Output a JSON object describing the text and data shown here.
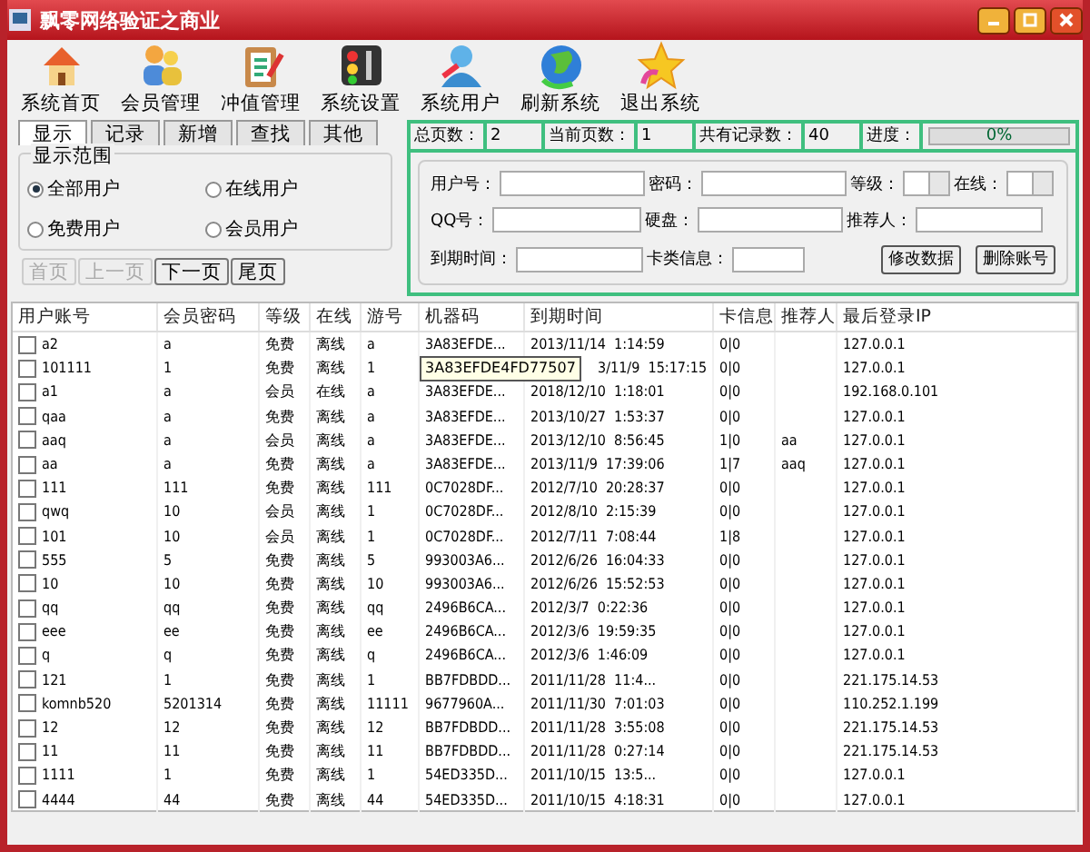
{
  "window": {
    "title": "飘零网络验证之商业"
  },
  "toolbar": [
    {
      "label": "系统首页"
    },
    {
      "label": "会员管理"
    },
    {
      "label": "冲值管理"
    },
    {
      "label": "系统设置"
    },
    {
      "label": "系统用户"
    },
    {
      "label": "刷新系统"
    },
    {
      "label": "退出系统"
    }
  ],
  "tabs": [
    {
      "label": "显示",
      "selected": true
    },
    {
      "label": "记录",
      "selected": false
    },
    {
      "label": "新增",
      "selected": false
    },
    {
      "label": "查找",
      "selected": false
    },
    {
      "label": "其他",
      "selected": false
    }
  ],
  "display_range": {
    "title": "显示范围",
    "options": [
      {
        "label": "全部用户",
        "selected": true
      },
      {
        "label": "在线用户",
        "selected": false
      },
      {
        "label": "免费用户",
        "selected": false
      },
      {
        "label": "会员用户",
        "selected": false
      }
    ]
  },
  "pager": [
    {
      "label": "首页",
      "disabled": true
    },
    {
      "label": "上一页",
      "disabled": true
    },
    {
      "label": "下一页",
      "disabled": false
    },
    {
      "label": "尾页",
      "disabled": false
    }
  ],
  "stats": {
    "total_pages_label": "总页数：",
    "total_pages": "2",
    "current_page_label": "当前页数：",
    "current_page": "1",
    "records_label": "共有记录数：",
    "records": "40",
    "progress_label": "进度：",
    "progress": {
      "level": 0,
      "reading": "0%"
    }
  },
  "form": {
    "user_label": "用户号：",
    "password_label": "密码：",
    "level_label": "等级：",
    "online_label": "在线：",
    "qq_label": "QQ号：",
    "disk_label": "硬盘：",
    "referrer_label": "推荐人：",
    "expiry_label": "到期时间：",
    "card_label": "卡类信息：",
    "buttons": [
      "修改数据",
      "删除账号"
    ]
  },
  "table": {
    "columns": [
      "用户账号",
      "会员密码",
      "等级",
      "在线",
      "游号",
      "机器码",
      "到期时间",
      "卡信息",
      "推荐人",
      "最后登录IP"
    ],
    "rows": [
      {
        "checked": false,
        "cells": [
          "a2",
          "a",
          "免费",
          "离线",
          "a",
          "3A83EFDE...",
          "2013/11/14  1:14:59",
          "0|0",
          "",
          "127.0.0.1"
        ]
      },
      {
        "checked": false,
        "cells": [
          "101111",
          "1",
          "免费",
          "离线",
          "1",
          "3A83EFDE4FD77507",
          "3/11/9  15:17:15",
          "0|0",
          "",
          "127.0.0.1"
        ],
        "tooltip": true
      },
      {
        "checked": false,
        "cells": [
          "a1",
          "a",
          "会员",
          "在线",
          "a",
          "3A83EFDE...",
          "2018/12/10  1:18:01",
          "0|0",
          "",
          "192.168.0.101"
        ]
      },
      {
        "checked": false,
        "cells": [
          "qaa",
          "a",
          "免费",
          "离线",
          "a",
          "3A83EFDE...",
          "2013/10/27  1:53:37",
          "0|0",
          "",
          "127.0.0.1"
        ]
      },
      {
        "checked": false,
        "cells": [
          "aaq",
          "a",
          "会员",
          "离线",
          "a",
          "3A83EFDE...",
          "2013/12/10  8:56:45",
          "1|0",
          "aa",
          "127.0.0.1"
        ]
      },
      {
        "checked": false,
        "cells": [
          "aa",
          "a",
          "免费",
          "离线",
          "a",
          "3A83EFDE...",
          "2013/11/9  17:39:06",
          "1|7",
          "aaq",
          "127.0.0.1"
        ]
      },
      {
        "checked": false,
        "cells": [
          "111",
          "111",
          "免费",
          "离线",
          "111",
          "0C7028DF...",
          "2012/7/10  20:28:37",
          "0|0",
          "",
          "127.0.0.1"
        ]
      },
      {
        "checked": false,
        "cells": [
          "qwq",
          "10",
          "会员",
          "离线",
          "1",
          "0C7028DF...",
          "2012/8/10  2:15:39",
          "0|0",
          "",
          "127.0.0.1"
        ]
      },
      {
        "checked": false,
        "cells": [
          "101",
          "10",
          "会员",
          "离线",
          "1",
          "0C7028DF...",
          "2012/7/11  7:08:44",
          "1|8",
          "",
          "127.0.0.1"
        ]
      },
      {
        "checked": false,
        "cells": [
          "555",
          "5",
          "免费",
          "离线",
          "5",
          "993003A6...",
          "2012/6/26  16:04:33",
          "0|0",
          "",
          "127.0.0.1"
        ]
      },
      {
        "checked": false,
        "cells": [
          "10",
          "10",
          "免费",
          "离线",
          "10",
          "993003A6...",
          "2012/6/26  15:52:53",
          "0|0",
          "",
          "127.0.0.1"
        ]
      },
      {
        "checked": false,
        "cells": [
          "qq",
          "qq",
          "免费",
          "离线",
          "qq",
          "2496B6CA...",
          "2012/3/7  0:22:36",
          "0|0",
          "",
          "127.0.0.1"
        ]
      },
      {
        "checked": false,
        "cells": [
          "eee",
          "ee",
          "免费",
          "离线",
          "ee",
          "2496B6CA...",
          "2012/3/6  19:59:35",
          "0|0",
          "",
          "127.0.0.1"
        ]
      },
      {
        "checked": false,
        "cells": [
          "q",
          "q",
          "免费",
          "离线",
          "q",
          "2496B6CA...",
          "2012/3/6  1:46:09",
          "0|0",
          "",
          "127.0.0.1"
        ]
      },
      {
        "checked": false,
        "cells": [
          "121",
          "1",
          "免费",
          "离线",
          "1",
          "BB7FDBDD...",
          "2011/11/28  11:4...",
          "0|0",
          "",
          "221.175.14.53"
        ]
      },
      {
        "checked": false,
        "cells": [
          "komnb520",
          "5201314",
          "免费",
          "离线",
          "11111",
          "9677960A...",
          "2011/11/30  7:01:03",
          "0|0",
          "",
          "110.252.1.199"
        ]
      },
      {
        "checked": false,
        "cells": [
          "12",
          "12",
          "免费",
          "离线",
          "12",
          "BB7FDBDD...",
          "2011/11/28  3:55:08",
          "0|0",
          "",
          "221.175.14.53"
        ]
      },
      {
        "checked": false,
        "cells": [
          "11",
          "11",
          "免费",
          "离线",
          "11",
          "BB7FDBDD...",
          "2011/11/28  0:27:14",
          "0|0",
          "",
          "221.175.14.53"
        ]
      },
      {
        "checked": false,
        "cells": [
          "1111",
          "1",
          "免费",
          "离线",
          "1",
          "54ED335D...",
          "2011/10/15  13:5...",
          "0|0",
          "",
          "127.0.0.1"
        ]
      },
      {
        "checked": false,
        "cells": [
          "4444",
          "44",
          "免费",
          "离线",
          "44",
          "54ED335D...",
          "2011/10/15  4:18:31",
          "0|0",
          "",
          "127.0.0.1"
        ]
      }
    ]
  }
}
